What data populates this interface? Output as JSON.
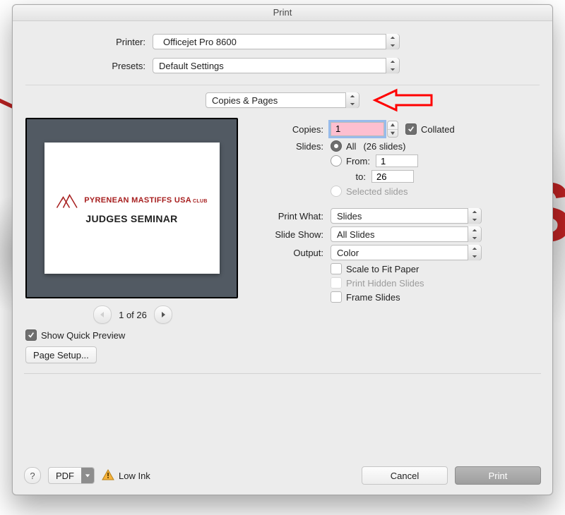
{
  "window": {
    "title": "Print"
  },
  "top": {
    "printer_label": "Printer:",
    "printer_value": "Officejet Pro 8600",
    "printer_warning": true,
    "presets_label": "Presets:",
    "presets_value": "Default Settings"
  },
  "pane": {
    "value": "Copies & Pages"
  },
  "preview": {
    "navigator": "1 of 26",
    "show_quick_preview_label": "Show Quick Preview",
    "show_quick_preview_checked": true,
    "page_setup_label": "Page Setup...",
    "slide_brand": "PYRENEAN MASTIFFS USA",
    "slide_brand_small": "CLUB",
    "slide_title": "JUDGES SEMINAR"
  },
  "opts": {
    "copies_label": "Copies:",
    "copies_value": "1",
    "collated_label": "Collated",
    "collated_checked": true,
    "slides_label": "Slides:",
    "all_label": "All",
    "all_note": "(26 slides)",
    "from_label": "From:",
    "from_value": "1",
    "to_label": "to:",
    "to_value": "26",
    "selected_label": "Selected slides",
    "slides_option": "all",
    "print_what_label": "Print What:",
    "print_what_value": "Slides",
    "slide_show_label": "Slide Show:",
    "slide_show_value": "All Slides",
    "output_label": "Output:",
    "output_value": "Color",
    "scale_label": "Scale to Fit Paper",
    "scale_checked": false,
    "hidden_label": "Print Hidden Slides",
    "hidden_enabled": false,
    "frame_label": "Frame Slides",
    "frame_checked": false
  },
  "footer": {
    "pdf_label": "PDF",
    "lowink_label": "Low Ink",
    "cancel_label": "Cancel",
    "print_label": "Print"
  }
}
